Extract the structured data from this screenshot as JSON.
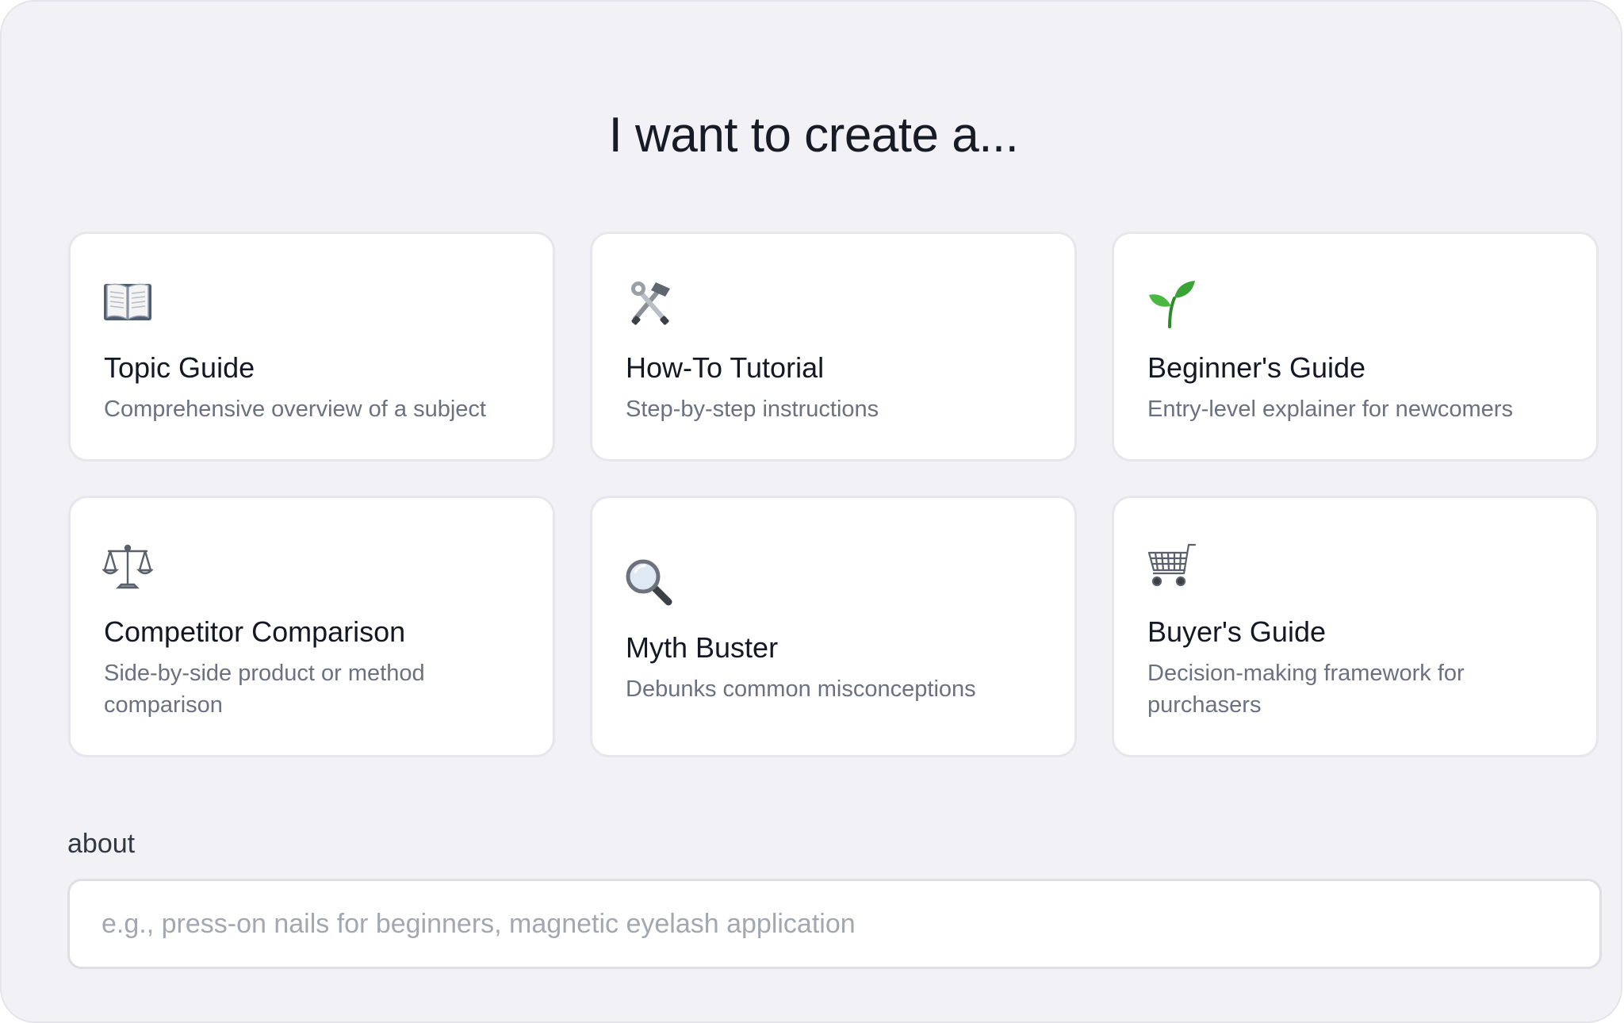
{
  "heading": "I want to create a...",
  "cards": [
    {
      "label": "Topic Guide",
      "description": "Comprehensive overview of a subject",
      "icon": "open-book-icon"
    },
    {
      "label": "How-To Tutorial",
      "description": "Step-by-step instructions",
      "icon": "hammer-wrench-icon"
    },
    {
      "label": "Beginner's Guide",
      "description": "Entry-level explainer for newcomers",
      "icon": "seedling-icon"
    },
    {
      "label": "Competitor Comparison",
      "description": "Side-by-side product or method comparison",
      "icon": "balance-scale-icon"
    },
    {
      "label": "Myth Buster",
      "description": "Debunks common misconceptions",
      "icon": "magnifying-glass-icon"
    },
    {
      "label": "Buyer's Guide",
      "description": "Decision-making framework for purchasers",
      "icon": "shopping-cart-icon"
    }
  ],
  "about": {
    "label": "about",
    "value": "",
    "placeholder": "e.g., press-on nails for beginners, magnetic eyelash application"
  },
  "colors": {
    "background": "#f2f2f6",
    "card": "#ffffff",
    "border": "#e6e6ec",
    "title": "#171b26",
    "description": "#6b7180",
    "placeholder": "#a3a7b2",
    "seedling": "#3aa335"
  }
}
